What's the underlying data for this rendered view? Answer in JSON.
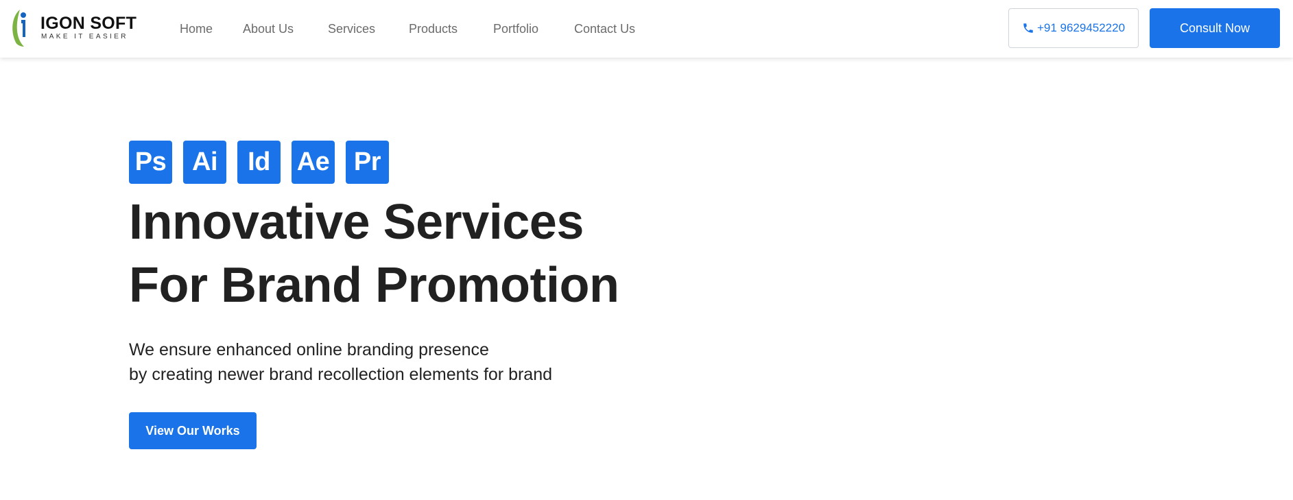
{
  "brand": {
    "name": "IGON SOFT",
    "tagline": "MAKE IT EASIER",
    "logo_icon": "person-leaf-logo-icon"
  },
  "nav": {
    "items": [
      {
        "label": "Home"
      },
      {
        "label": "About Us"
      },
      {
        "label": "Services"
      },
      {
        "label": "Products"
      },
      {
        "label": "Portfolio"
      },
      {
        "label": "Contact Us"
      }
    ]
  },
  "header_actions": {
    "phone": "+91 9629452220",
    "phone_icon": "phone-icon",
    "consult_label": "Consult Now"
  },
  "hero": {
    "badges": [
      "Ps",
      "Ai",
      "Id",
      "Ae",
      "Pr"
    ],
    "headline_line1": "Innovative Services",
    "headline_line2": "For Brand Promotion",
    "subtext_line1": "We ensure enhanced online branding presence",
    "subtext_line2": "by creating newer brand recollection elements for brand",
    "cta_label": "View Our Works"
  },
  "colors": {
    "accent": "#1a73e8",
    "text_dark": "#212121",
    "nav_text": "#6b6b6b",
    "logo_green": "#7cb342",
    "logo_blue": "#1565c0"
  }
}
